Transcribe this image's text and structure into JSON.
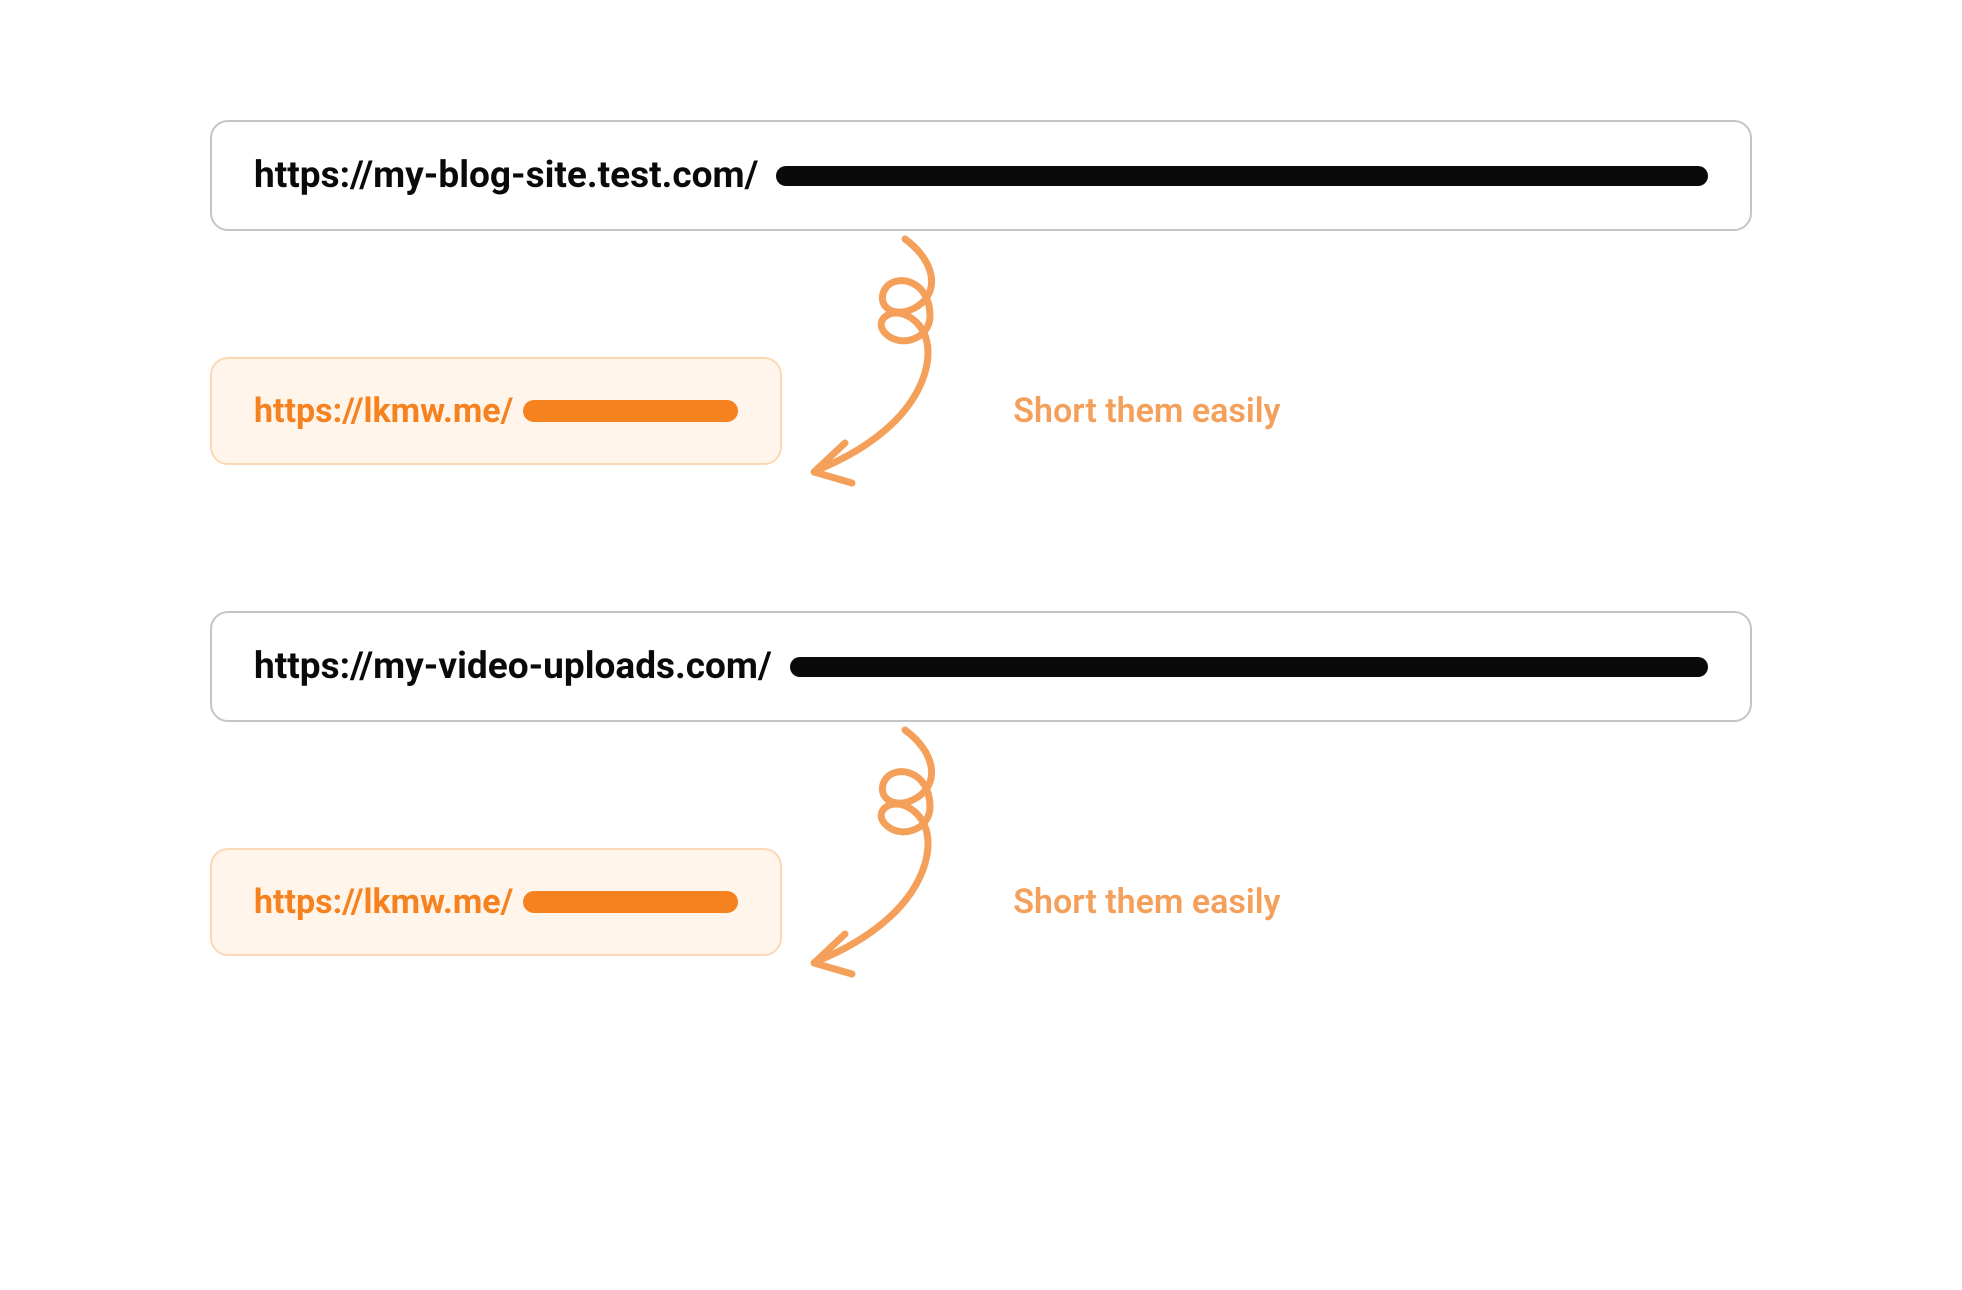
{
  "examples": [
    {
      "long_url": "https://my-blog-site.test.com/",
      "short_url": "https://lkmw.me/",
      "caption": "Short them easily"
    },
    {
      "long_url": "https://my-video-uploads.com/",
      "short_url": "https://lkmw.me/",
      "caption": "Short them easily"
    }
  ],
  "colors": {
    "accent": "#f5821f",
    "accent_light": "#f5a05a",
    "accent_bg": "#fff5eb",
    "accent_border": "#fcd7b3",
    "neutral_border": "#c5c5c5",
    "text": "#0a0a0a"
  }
}
